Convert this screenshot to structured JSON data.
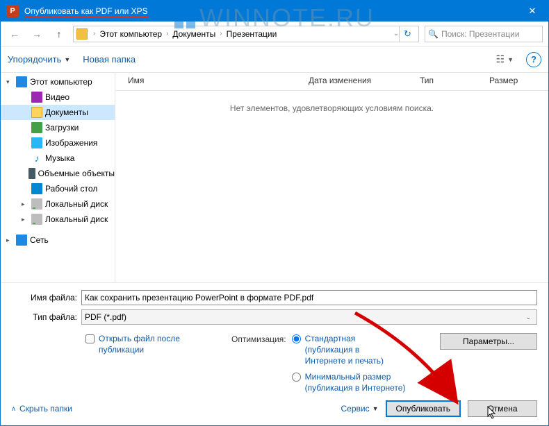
{
  "title": "Опубликовать как PDF или XPS",
  "watermark": "WINNOTE.RU",
  "breadcrumb": {
    "items": [
      "Этот компьютер",
      "Документы",
      "Презентации"
    ]
  },
  "search": {
    "placeholder": "Поиск: Презентации"
  },
  "toolbar": {
    "organize": "Упорядочить",
    "new_folder": "Новая папка"
  },
  "sidebar": {
    "items": [
      {
        "label": "Этот компьютер",
        "icon": "monitor",
        "exp": "open",
        "indent": 0
      },
      {
        "label": "Видео",
        "icon": "video",
        "exp": "none",
        "indent": 1
      },
      {
        "label": "Документы",
        "icon": "folder",
        "exp": "none",
        "indent": 1,
        "selected": true
      },
      {
        "label": "Загрузки",
        "icon": "downloads",
        "exp": "none",
        "indent": 1
      },
      {
        "label": "Изображения",
        "icon": "images",
        "exp": "none",
        "indent": 1
      },
      {
        "label": "Музыка",
        "icon": "music",
        "exp": "none",
        "indent": 1
      },
      {
        "label": "Объемные объекты",
        "icon": "3d",
        "exp": "none",
        "indent": 1
      },
      {
        "label": "Рабочий стол",
        "icon": "desktop",
        "exp": "none",
        "indent": 1
      },
      {
        "label": "Локальный диск",
        "icon": "drive",
        "exp": "closed",
        "indent": 1
      },
      {
        "label": "Локальный диск",
        "icon": "drive",
        "exp": "closed",
        "indent": 1
      },
      {
        "label": "Сеть",
        "icon": "network",
        "exp": "closed",
        "indent": 0
      }
    ]
  },
  "columns": {
    "name": "Имя",
    "date": "Дата изменения",
    "type": "Тип",
    "size": "Размер"
  },
  "empty_message": "Нет элементов, удовлетворяющих условиям поиска.",
  "fields": {
    "filename_label": "Имя файла:",
    "filename_value": "Как сохранить презентацию PowerPoint в формате PDF.pdf",
    "filetype_label": "Тип файла:",
    "filetype_value": "PDF (*.pdf)"
  },
  "options": {
    "open_after": "Открыть файл после публикации",
    "optimization_label": "Оптимизация:",
    "standard": "Стандартная (публикация в Интернете и печать)",
    "minimum": "Минимальный размер (публикация в Интернете)",
    "params_button": "Параметры..."
  },
  "footer": {
    "hide_folders": "Скрыть папки",
    "tools": "Сервис",
    "publish": "Опубликовать",
    "cancel": "Отмена"
  }
}
